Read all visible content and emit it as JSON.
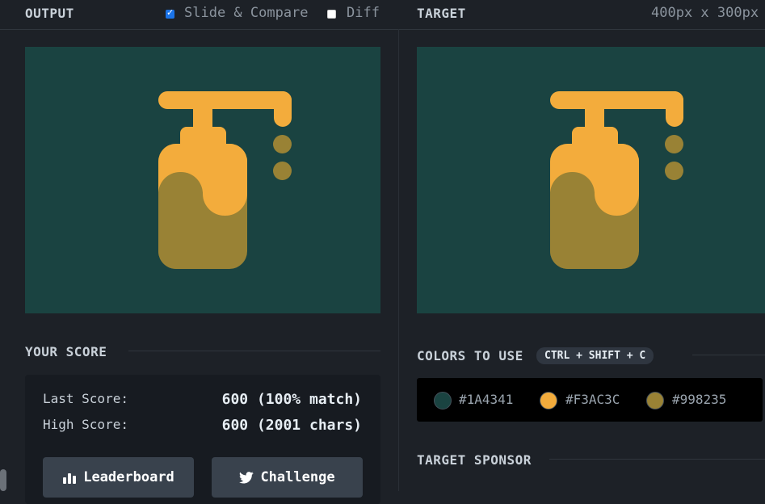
{
  "output": {
    "title": "OUTPUT",
    "slide_compare_label": "Slide & Compare",
    "slide_compare_checked": true,
    "diff_label": "Diff",
    "diff_checked": false
  },
  "target": {
    "title": "TARGET",
    "dimensions": "400px x 300px"
  },
  "score": {
    "title": "YOUR SCORE",
    "last_label": "Last Score:",
    "last_value": "600 (100% match)",
    "high_label": "High Score:",
    "high_value": "600 (2001 chars)",
    "leaderboard_label": "Leaderboard",
    "challenge_label": "Challenge"
  },
  "colors": {
    "title": "COLORS TO USE",
    "shortcut": "CTRL + SHIFT + C",
    "palette": [
      {
        "hex_label": "#1A4341",
        "color": "#1A4341"
      },
      {
        "hex_label": "#F3AC3C",
        "color": "#F3AC3C"
      },
      {
        "hex_label": "#998235",
        "color": "#998235"
      }
    ]
  },
  "sponsor": {
    "title": "TARGET SPONSOR"
  },
  "icons": [
    "checkbox",
    "bar-chart-icon",
    "twitter-icon",
    "soap-dispenser-graphic"
  ]
}
